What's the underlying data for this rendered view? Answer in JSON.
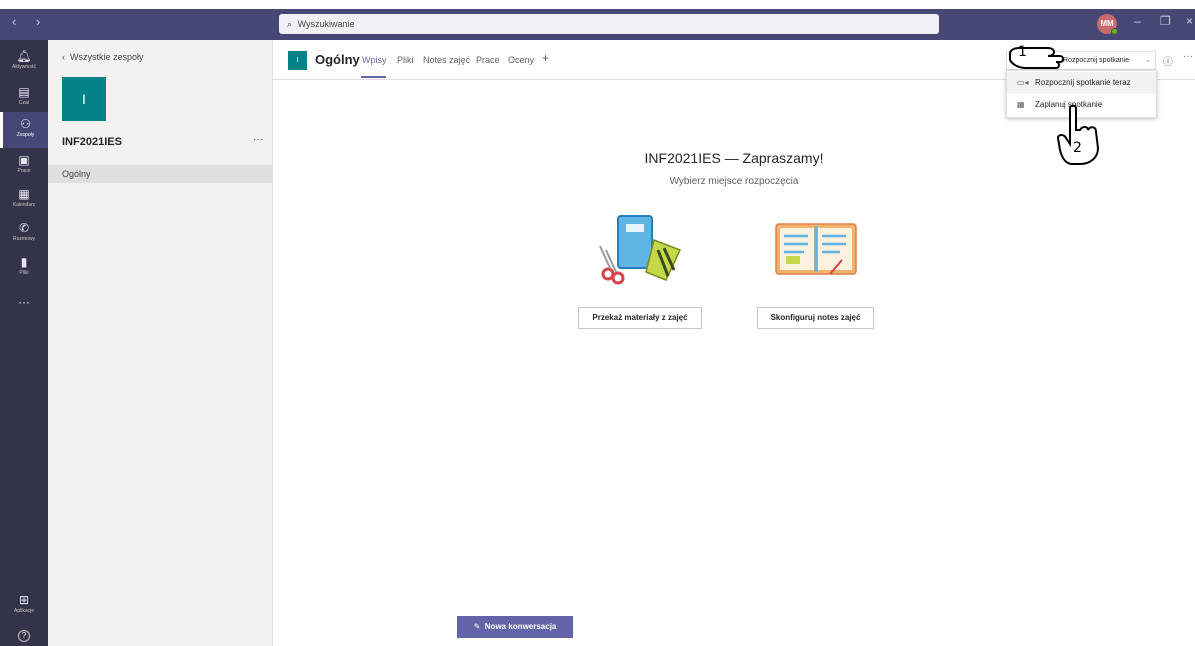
{
  "titlebar": {
    "search_placeholder": "Wyszukiwanie",
    "avatar_initials": "MM",
    "nav_back": "‹",
    "nav_forward": "›",
    "minimize": "–",
    "restore": "❐",
    "close": "×"
  },
  "rail": {
    "items": [
      {
        "label": "Aktywność",
        "icon": "bell-icon",
        "glyph": "🔔"
      },
      {
        "label": "Czat",
        "icon": "chat-icon",
        "glyph": "▤"
      },
      {
        "label": "Zespoły",
        "icon": "teams-icon",
        "glyph": "⚇"
      },
      {
        "label": "Prace",
        "icon": "assignments-icon",
        "glyph": "▣"
      },
      {
        "label": "Kalendarz",
        "icon": "calendar-icon",
        "glyph": "▦"
      },
      {
        "label": "Rozmowy",
        "icon": "phone-icon",
        "glyph": "✆"
      },
      {
        "label": "Pliki",
        "icon": "files-icon",
        "glyph": "▮"
      }
    ],
    "more": "···",
    "apps_label": "Aplikacje",
    "apps_glyph": "⊞",
    "help_glyph": "?"
  },
  "team": {
    "back_label": "Wszystkie zespoły",
    "tile_letter": "I",
    "name": "INF2021IES",
    "more": "···",
    "channel": "Ogólny"
  },
  "channel_header": {
    "tile_letter": "I",
    "name": "Ogólny",
    "tabs": [
      "Wpisy",
      "Pliki",
      "Notes zajęć",
      "Prace",
      "Oceny"
    ],
    "add_tab": "+",
    "meet_button": "Rozpocznij spotkanie",
    "info": "ⓘ",
    "more": "···"
  },
  "dropdown": {
    "items": [
      "Rozpocznij spotkanie teraz",
      "Zaplanuj spotkanie"
    ]
  },
  "welcome": {
    "title": "INF2021IES — Zapraszamy!",
    "subtitle": "Wybierz miejsce rozpoczęcia",
    "cta_left": "Przekaż materiały z zajęć",
    "cta_right": "Skonfiguruj notes zajęć"
  },
  "compose": {
    "new_conversation": "Nowa konwersacja"
  },
  "annotations": {
    "step1": "1",
    "step2": "2"
  },
  "colors": {
    "titlebar": "#464775",
    "rail": "#33344a",
    "accent": "#6264a7",
    "team_tile": "#038387"
  }
}
